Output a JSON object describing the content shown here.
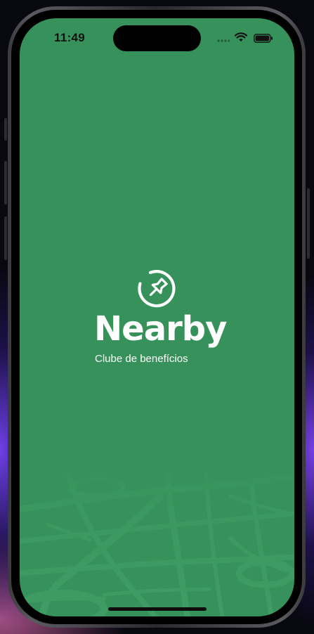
{
  "status_bar": {
    "time": "11:49",
    "icons": [
      "cellular-signal-icon",
      "wifi-icon",
      "battery-icon"
    ]
  },
  "splash": {
    "brand_name": "Nearby",
    "tagline": "Clube de benefícios",
    "logo_icon": "map-pin-icon"
  },
  "colors": {
    "background": "#36925a",
    "map_lines": "#3d9a62",
    "text": "#ffffff",
    "status_text": "#111111"
  }
}
